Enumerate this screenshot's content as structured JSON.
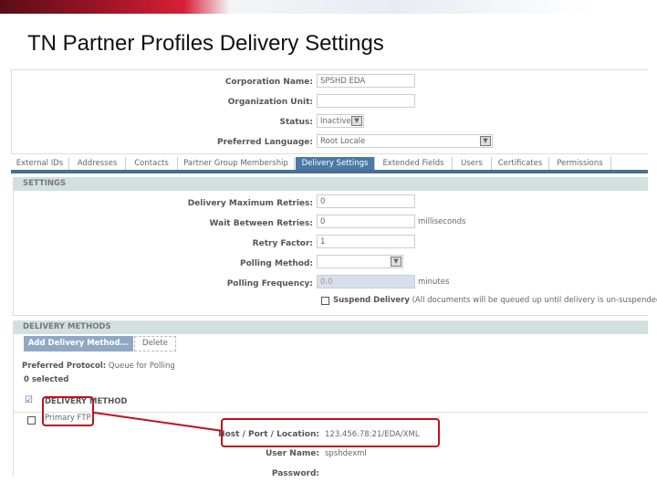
{
  "slide_title": "TN Partner Profiles Delivery Settings",
  "profile": {
    "corporation_name_label": "Corporation Name:",
    "corporation_name": "SPSHD EDA",
    "org_unit_label": "Organization Unit:",
    "org_unit": "",
    "status_label": "Status:",
    "status": "Inactive",
    "language_label": "Preferred Language:",
    "language": "Root Locale"
  },
  "tabs": [
    "External IDs",
    "Addresses",
    "Contacts",
    "Partner Group Membership",
    "Delivery Settings",
    "Extended Fields",
    "Users",
    "Certificates",
    "Permissions"
  ],
  "active_tab": "Delivery Settings",
  "settings": {
    "header": "SETTINGS",
    "max_retries_label": "Delivery Maximum Retries:",
    "max_retries": "0",
    "wait_label": "Wait Between Retries:",
    "wait": "0",
    "wait_unit": "milliseconds",
    "retry_factor_label": "Retry Factor:",
    "retry_factor": "1",
    "polling_method_label": "Polling Method:",
    "polling_method": "",
    "polling_freq_label": "Polling Frequency:",
    "polling_freq": "0.0",
    "polling_freq_unit": "minutes",
    "suspend_label": "Suspend Delivery",
    "suspend_note": "(All documents will be queued up until delivery is un-suspended)"
  },
  "delivery_methods": {
    "header": "DELIVERY METHODS",
    "add_button": "Add Delivery Method...",
    "delete_button": "Delete",
    "preferred_protocol_label": "Preferred Protocol:",
    "preferred_protocol": "Queue for Polling",
    "selected_count": "0 selected",
    "column_header": "DELIVERY METHOD",
    "rows": [
      "Primary FTP"
    ],
    "host_label": "Host / Port / Location:",
    "host": "123.456.78:21/EDA/XML",
    "user_label": "User Name:",
    "user": "spshdexml",
    "password_label": "Password:"
  },
  "colors": {
    "accent": "#4a7aa5",
    "annotation": "#c0101f"
  }
}
